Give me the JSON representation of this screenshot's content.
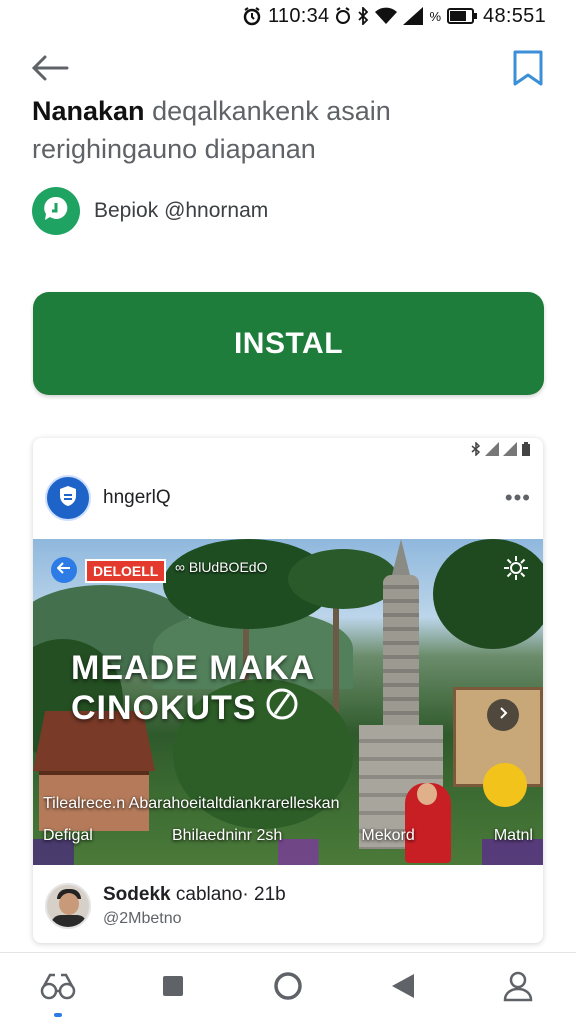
{
  "status_bar": {
    "time": "110:34",
    "battery_text": "48:551",
    "percent_symbol": "%"
  },
  "header": {
    "title_bold": "Nanakan",
    "title_rest": " deqalkankenk asain rerighingauno diapanan"
  },
  "developer": {
    "name": "Bepiok",
    "handle": "@hnornam"
  },
  "install_button": {
    "label": "INSTAL"
  },
  "post": {
    "account_name": "hngerlQ",
    "more_label": "•••",
    "media": {
      "tag": "DELOELL",
      "tag_sub": "∞ BlUdBOEdO",
      "headline_line1": "MEADE MAKA",
      "headline_line2": "CINOKUTS",
      "caption": "Tilealrece.n Abarahoeitaltdiankrarelleskan",
      "label_left": "Defigal",
      "label_center": "Bhilaedninr 2sh",
      "label_mid": "Mekord",
      "label_right": "Matnl"
    },
    "footer": {
      "name_bold": "Sodekk",
      "name_rest": " cablano· 21b",
      "handle": "@2Mbetno"
    }
  },
  "nav": {
    "items": [
      {
        "icon": "glasses-icon"
      },
      {
        "icon": "square-icon"
      },
      {
        "icon": "circle-icon"
      },
      {
        "icon": "back-triangle-icon"
      },
      {
        "icon": "person-icon"
      }
    ]
  },
  "colors": {
    "install_green": "#1e7d3a",
    "developer_logo_green": "#1ea362",
    "accent_blue": "#2d7be5",
    "tag_red": "#e43a2e"
  }
}
